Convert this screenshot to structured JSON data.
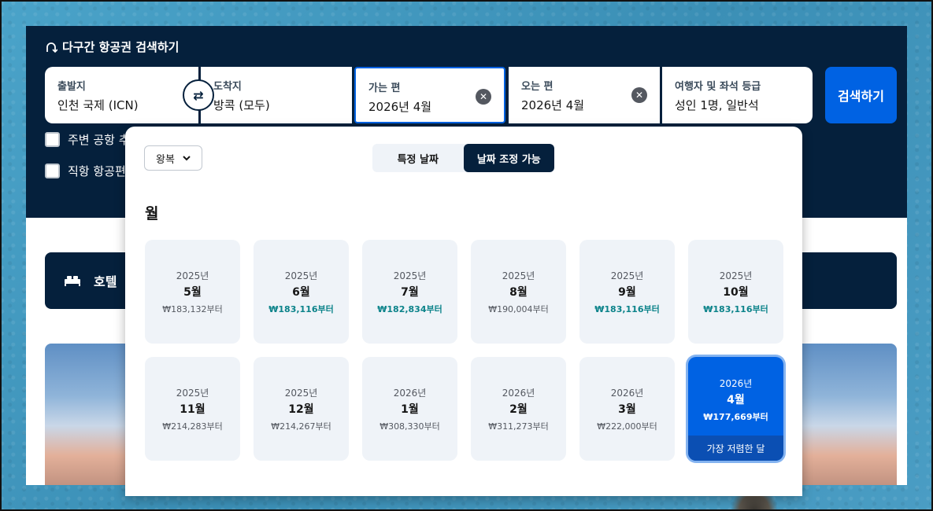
{
  "header": {
    "title": "다구간 항공권 검색하기",
    "icon": "multi-city-icon"
  },
  "search": {
    "origin": {
      "label": "출발지",
      "value": "인천 국제 (ICN)"
    },
    "destination": {
      "label": "도착지",
      "value": "방콕 (모두)"
    },
    "depart": {
      "label": "가는 편",
      "value": "2026년 4월"
    },
    "return": {
      "label": "오는 편",
      "value": "2026년 4월"
    },
    "travellers": {
      "label": "여행자 및 좌석 등급",
      "value": "성인 1명, 일반석"
    },
    "search_button": "검색하기",
    "swap_icon": "⇄",
    "clear_icon": "✕"
  },
  "options": {
    "nearby_airports": "주변 공항 추",
    "direct_flights": "직항 항공편"
  },
  "hotel_bar": {
    "label": "호텔",
    "icon": "bed-icon"
  },
  "picker": {
    "trip_type": "왕복",
    "toggle": {
      "specific": "특정 날짜",
      "flexible": "날짜 조정 가능"
    },
    "heading": "월",
    "months": [
      {
        "year": "2025년",
        "month": "5월",
        "price": "₩183,132부터",
        "cheap": false
      },
      {
        "year": "2025년",
        "month": "6월",
        "price": "₩183,116부터",
        "cheap": true
      },
      {
        "year": "2025년",
        "month": "7월",
        "price": "₩182,834부터",
        "cheap": true
      },
      {
        "year": "2025년",
        "month": "8월",
        "price": "₩190,004부터",
        "cheap": false
      },
      {
        "year": "2025년",
        "month": "9월",
        "price": "₩183,116부터",
        "cheap": true
      },
      {
        "year": "2025년",
        "month": "10월",
        "price": "₩183,116부터",
        "cheap": true
      },
      {
        "year": "2025년",
        "month": "11월",
        "price": "₩214,283부터",
        "cheap": false
      },
      {
        "year": "2025년",
        "month": "12월",
        "price": "₩214,267부터",
        "cheap": false
      },
      {
        "year": "2026년",
        "month": "1월",
        "price": "₩308,330부터",
        "cheap": false
      },
      {
        "year": "2026년",
        "month": "2월",
        "price": "₩311,273부터",
        "cheap": false
      },
      {
        "year": "2026년",
        "month": "3월",
        "price": "₩222,000부터",
        "cheap": false
      },
      {
        "year": "2026년",
        "month": "4월",
        "price": "₩177,669부터",
        "cheap": false,
        "selected": true,
        "tag": "가장 저렴한 달"
      }
    ]
  },
  "colors": {
    "navy": "#05203c",
    "blue": "#0062e3",
    "teal": "#0c838a"
  }
}
